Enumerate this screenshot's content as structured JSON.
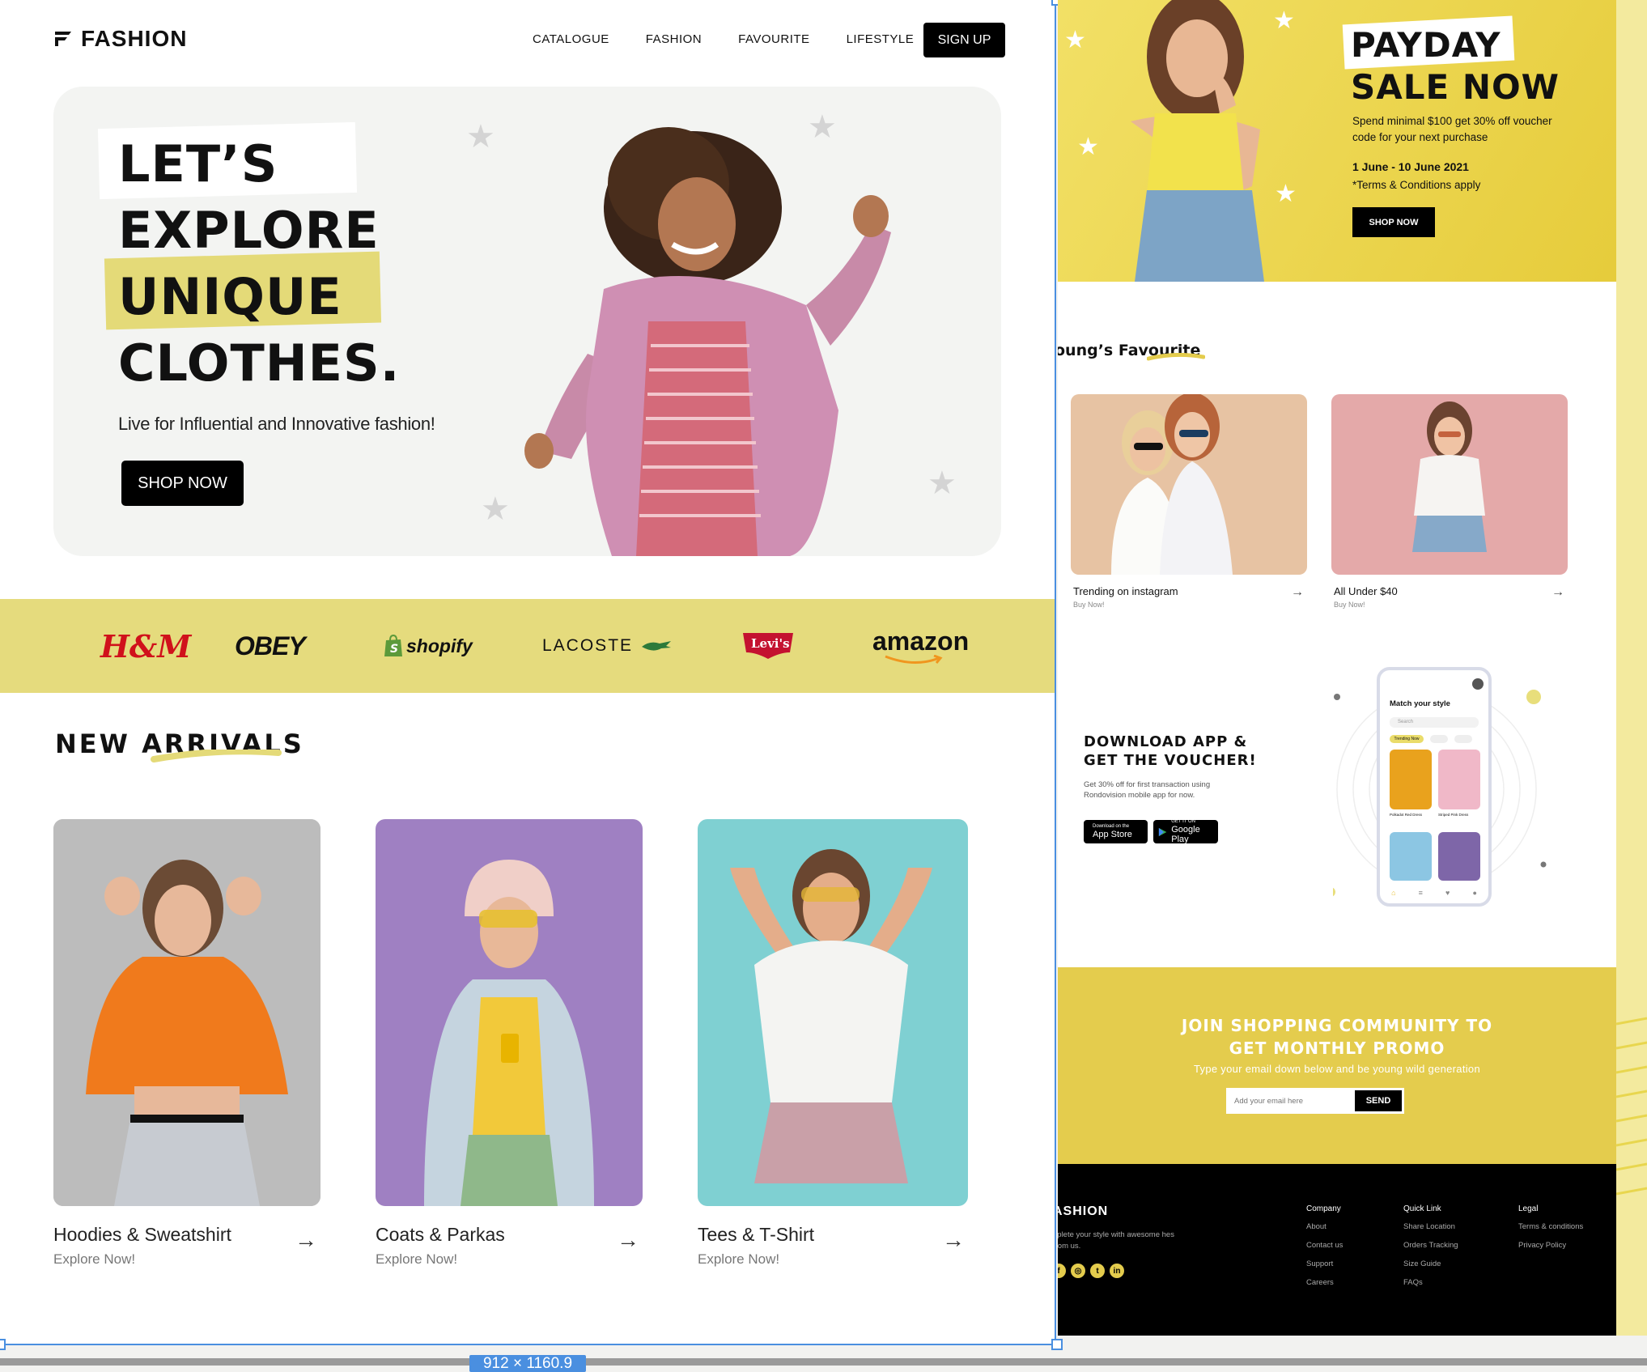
{
  "nav": {
    "logo": "FASHION",
    "links": [
      "CATALOGUE",
      "FASHION",
      "FAVOURITE",
      "LIFESTYLE"
    ],
    "signup": "SIGN UP"
  },
  "hero": {
    "title_lines": [
      "LET’S",
      "EXPLORE",
      "UNIQUE",
      "CLOTHES."
    ],
    "subtitle": "Live for Influential and Innovative fashion!",
    "cta": "SHOP NOW"
  },
  "brands": {
    "hm": "H&M",
    "obey": "OBEY",
    "shopify": "shopify",
    "lacoste": "LACOSTE",
    "levis": "Levi's",
    "amazon": "amazon"
  },
  "arrivals": {
    "title": "NEW ARRIVALS",
    "items": [
      {
        "name": "Hoodies & Sweatshirt",
        "sub": "Explore Now!",
        "arrow": "→"
      },
      {
        "name": "Coats & Parkas",
        "sub": "Explore Now!",
        "arrow": "→"
      },
      {
        "name": "Tees & T-Shirt",
        "sub": "Explore Now!",
        "arrow": "→"
      }
    ]
  },
  "payday": {
    "title1": "PAYDAY",
    "title2": "SALE NOW",
    "desc": "Spend minimal $100 get 30% off voucher code for your next purchase",
    "date": "1 June - 10 June 2021",
    "terms": "*Terms & Conditions apply",
    "cta": "SHOP NOW"
  },
  "favourite": {
    "title": "oung’s Favourite",
    "items": [
      {
        "name": "Trending on instagram",
        "sub": "Buy Now!",
        "arrow": "→"
      },
      {
        "name": "All Under $40",
        "sub": "Buy Now!",
        "arrow": "→"
      }
    ]
  },
  "app": {
    "title1": "DOWNLOAD APP &",
    "title2": "GET THE VOUCHER!",
    "desc": "Get 30% off for first transaction using Rondovision mobile app for now.",
    "appstore_small": "Download on the",
    "appstore_big": "App Store",
    "play_small": "GET IT ON",
    "play_big": "Google Play",
    "phone_title": "Match your style",
    "phone_search": "Search",
    "phone_chip": "Trending Now",
    "phone_item1": "Polkadot Red Dress",
    "phone_item2": "Striped Pink Dress"
  },
  "promo": {
    "title1": "JOIN SHOPPING COMMUNITY TO",
    "title2": "GET MONTHLY PROMO",
    "subtitle": "Type your email down below and be young wild generation",
    "placeholder": "Add your email here",
    "send": "SEND"
  },
  "footer": {
    "brand": "ASHION",
    "tagline": "nplete your style with awesome hes from us.",
    "company": {
      "heading": "Company",
      "links": [
        "About",
        "Contact us",
        "Support",
        "Careers"
      ]
    },
    "quick": {
      "heading": "Quick Link",
      "links": [
        "Share Location",
        "Orders Tracking",
        "Size Guide",
        "FAQs"
      ]
    },
    "legal": {
      "heading": "Legal",
      "links": [
        "Terms & conditions",
        "Privacy Policy"
      ]
    }
  },
  "canvas": {
    "dimension_label": "912 × 1160.9"
  },
  "colors": {
    "accent": "#e5db7d",
    "promo": "#e4cc4d",
    "selection": "#4a8fe0",
    "dark": "#000000"
  }
}
